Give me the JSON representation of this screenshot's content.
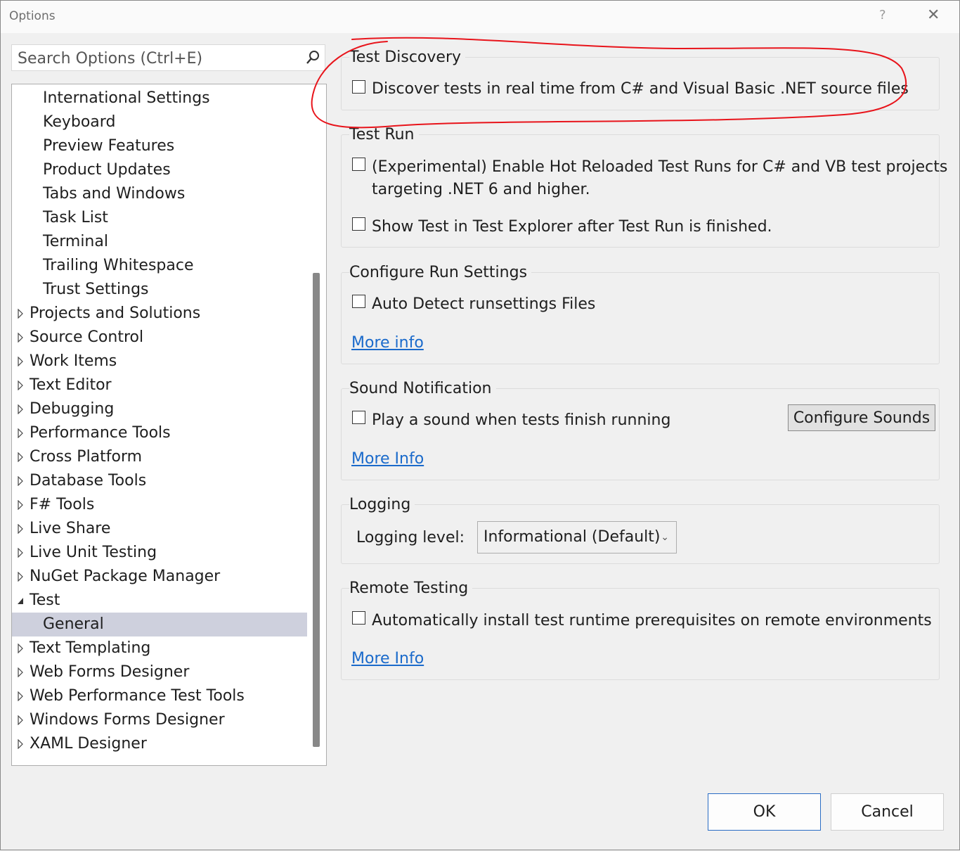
{
  "window": {
    "title": "Options",
    "help": "?",
    "close": "✕"
  },
  "search": {
    "placeholder": "Search Options (Ctrl+E)",
    "value": ""
  },
  "tree": [
    {
      "label": "International Settings",
      "indent": 1,
      "caret": "none"
    },
    {
      "label": "Keyboard",
      "indent": 1,
      "caret": "none"
    },
    {
      "label": "Preview Features",
      "indent": 1,
      "caret": "none"
    },
    {
      "label": "Product Updates",
      "indent": 1,
      "caret": "none"
    },
    {
      "label": "Tabs and Windows",
      "indent": 1,
      "caret": "none"
    },
    {
      "label": "Task List",
      "indent": 1,
      "caret": "none"
    },
    {
      "label": "Terminal",
      "indent": 1,
      "caret": "none"
    },
    {
      "label": "Trailing Whitespace",
      "indent": 1,
      "caret": "none"
    },
    {
      "label": "Trust Settings",
      "indent": 1,
      "caret": "none"
    },
    {
      "label": "Projects and Solutions",
      "indent": 0,
      "caret": "collapsed"
    },
    {
      "label": "Source Control",
      "indent": 0,
      "caret": "collapsed"
    },
    {
      "label": "Work Items",
      "indent": 0,
      "caret": "collapsed"
    },
    {
      "label": "Text Editor",
      "indent": 0,
      "caret": "collapsed"
    },
    {
      "label": "Debugging",
      "indent": 0,
      "caret": "collapsed"
    },
    {
      "label": "Performance Tools",
      "indent": 0,
      "caret": "collapsed"
    },
    {
      "label": "Cross Platform",
      "indent": 0,
      "caret": "collapsed"
    },
    {
      "label": "Database Tools",
      "indent": 0,
      "caret": "collapsed"
    },
    {
      "label": "F# Tools",
      "indent": 0,
      "caret": "collapsed"
    },
    {
      "label": "Live Share",
      "indent": 0,
      "caret": "collapsed"
    },
    {
      "label": "Live Unit Testing",
      "indent": 0,
      "caret": "collapsed"
    },
    {
      "label": "NuGet Package Manager",
      "indent": 0,
      "caret": "collapsed"
    },
    {
      "label": "Test",
      "indent": 0,
      "caret": "expanded"
    },
    {
      "label": "General",
      "indent": 1,
      "caret": "none",
      "selected": true
    },
    {
      "label": "Text Templating",
      "indent": 0,
      "caret": "collapsed"
    },
    {
      "label": "Web Forms Designer",
      "indent": 0,
      "caret": "collapsed"
    },
    {
      "label": "Web Performance Test Tools",
      "indent": 0,
      "caret": "collapsed"
    },
    {
      "label": "Windows Forms Designer",
      "indent": 0,
      "caret": "collapsed"
    },
    {
      "label": "XAML Designer",
      "indent": 0,
      "caret": "collapsed"
    }
  ],
  "test_discovery": {
    "title": "Test Discovery",
    "realtime_label": "Discover tests in real time from C# and Visual Basic .NET source files",
    "realtime_checked": false
  },
  "test_run": {
    "title": "Test Run",
    "hot_reload_line1": "(Experimental) Enable Hot Reloaded Test Runs for C# and VB test projects",
    "hot_reload_line2": "targeting .NET 6 and higher.",
    "hot_reload_checked": false,
    "show_test_label": "Show Test in Test Explorer after Test Run is finished.",
    "show_test_checked": false
  },
  "run_settings": {
    "title": "Configure Run Settings",
    "auto_detect_label": "Auto Detect runsettings Files",
    "auto_detect_checked": false,
    "more_info": "More info"
  },
  "sound": {
    "title": "Sound Notification",
    "play_label": "Play a sound when tests finish running",
    "play_checked": false,
    "configure_button": "Configure Sounds",
    "more_info": "More Info"
  },
  "logging": {
    "title": "Logging",
    "level_label": "Logging level:",
    "level_value": "Informational (Default)"
  },
  "remote": {
    "title": "Remote Testing",
    "install_label": "Automatically install test runtime prerequisites on remote environments",
    "install_checked": false,
    "more_info": "More Info"
  },
  "footer": {
    "ok": "OK",
    "cancel": "Cancel"
  },
  "annotation": {
    "color": "#e8141b"
  },
  "colors": {
    "link": "#1a6acb",
    "selection": "#ced0dd",
    "ok_border": "#2a6cc4"
  }
}
